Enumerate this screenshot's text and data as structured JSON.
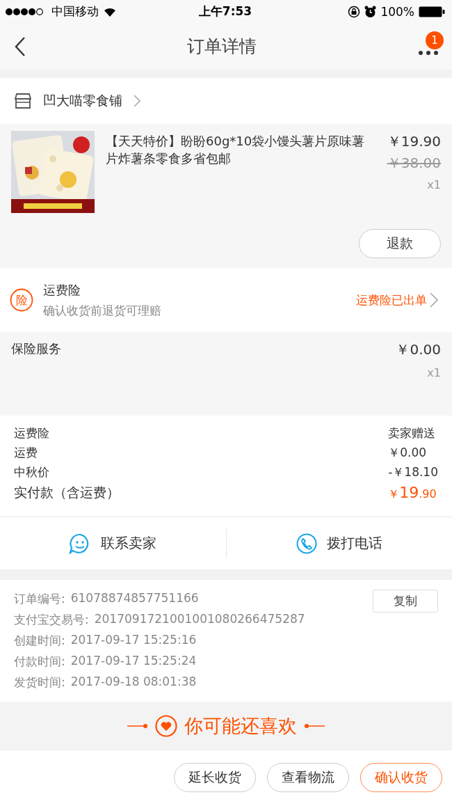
{
  "status_bar": {
    "carrier": "中国移动",
    "time": "上午7:53",
    "battery": "100%"
  },
  "nav": {
    "title": "订单详情",
    "badge": "1"
  },
  "shop": {
    "name": "凹大喵零食铺"
  },
  "product": {
    "kind": "picture",
    "title": "【天天特价】盼盼60g*10袋小馒头薯片原味薯片炸薯条零食多省包邮",
    "price": "￥19.90",
    "original_price": "￥38.00",
    "quantity": "x1",
    "refund_button": "退款"
  },
  "shipping_insurance": {
    "icon_text": "险",
    "title": "运费险",
    "subtitle": "确认收货前退货可理赔",
    "status": "运费险已出单"
  },
  "insurance_service": {
    "title": "保险服务",
    "price": "￥0.00",
    "quantity": "x1"
  },
  "summary": {
    "rows": [
      {
        "label": "运费险",
        "value": "卖家赠送"
      },
      {
        "label": "运费",
        "value": "￥0.00"
      },
      {
        "label": "中秋价",
        "value": "-￥18.10"
      }
    ],
    "total_label": "实付款（含运费）",
    "total_symbol": "￥",
    "total_integer": "19",
    "total_decimal": ".90"
  },
  "contact": [
    {
      "kind": "chat",
      "label": "联系卖家"
    },
    {
      "kind": "phone",
      "label": "拨打电话"
    }
  ],
  "order_info": {
    "copy_button": "复制",
    "rows": [
      {
        "label": "订单编号:",
        "value": "61078874857751166"
      },
      {
        "label": "支付宝交易号:",
        "value": "2017091721001001080266475287"
      },
      {
        "label": "创建时间:",
        "value": "2017-09-17 15:25:16"
      },
      {
        "label": "付款时间:",
        "value": "2017-09-17 15:25:24"
      },
      {
        "label": "发货时间:",
        "value": "2017-09-18 08:01:38"
      }
    ]
  },
  "recommend": {
    "title": "你可能还喜欢"
  },
  "actions": [
    {
      "label": "延长收货",
      "primary": false
    },
    {
      "label": "查看物流",
      "primary": false
    },
    {
      "label": "确认收货",
      "primary": true
    }
  ]
}
